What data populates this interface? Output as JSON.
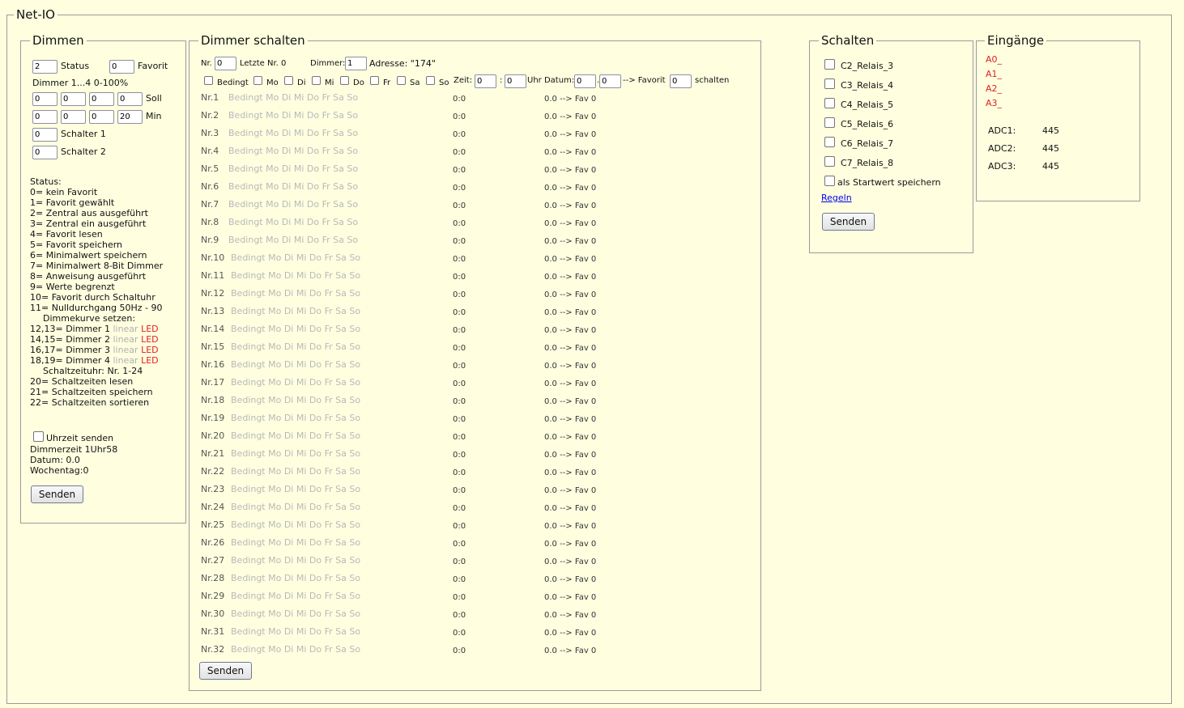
{
  "netio": {
    "legend": "Net-IO"
  },
  "dimmen": {
    "legend": "Dimmen",
    "status_value": "2",
    "status_label": "Status",
    "favorit_value": "0",
    "favorit_label": "Favorit",
    "range_label": "Dimmer 1...4 0-100%",
    "soll_values": [
      "0",
      "0",
      "0",
      "0"
    ],
    "soll_label": "Soll",
    "min_values": [
      "0",
      "0",
      "0",
      "20"
    ],
    "min_label": "Min",
    "schalter1_value": "0",
    "schalter1_label": "Schalter 1",
    "schalter2_value": "0",
    "schalter2_label": "Schalter 2",
    "status_header": "Status:",
    "status_lines": [
      "0= kein Favorit",
      "1= Favorit gewählt",
      "2= Zentral aus ausgeführt",
      "3= Zentral ein ausgeführt",
      "4= Favorit lesen",
      "5= Favorit speichern",
      "6= Minimalwert speichern",
      "7= Minimalwert 8-Bit Dimmer",
      "8= Anweisung ausgeführt",
      "9= Werte begrenzt",
      "10= Favorit durch Schaltuhr",
      "11= Nulldurchgang 50Hz - 90"
    ],
    "dimmkurve_label": "Dimmekurve setzen:",
    "curve_lines": [
      {
        "prefix": "12,13= Dimmer 1",
        "linear": "linear",
        "led": "LED"
      },
      {
        "prefix": "14,15= Dimmer 2",
        "linear": "linear",
        "led": "LED"
      },
      {
        "prefix": "16,17= Dimmer 3",
        "linear": "linear",
        "led": "LED"
      },
      {
        "prefix": "18,19= Dimmer 4",
        "linear": "linear",
        "led": "LED"
      }
    ],
    "schaltzeituhr_label": "Schaltzeituhr: Nr. 1-24",
    "schalt_lines": [
      "20= Schaltzeiten lesen",
      "21= Schaltzeiten speichern",
      "22= Schaltzeiten sortieren"
    ],
    "uhrzeit_label": "Uhrzeit senden",
    "dimmerzeit": "Dimmerzeit 1Uhr58",
    "datum": "Datum: 0.0",
    "wochentag": "Wochentag:0",
    "send_label": "Senden"
  },
  "dimmer_schalten": {
    "legend": "Dimmer schalten",
    "nr_label": "Nr.",
    "nr_value": "0",
    "letzte_label": "Letzte Nr. 0",
    "dimmer_label": "Dimmer:",
    "dimmer_value": "1",
    "adresse_label": "Adresse: \"174\"",
    "day_labels": [
      "Bedingt",
      "Mo",
      "Di",
      "Mi",
      "Do",
      "Fr",
      "Sa",
      "So"
    ],
    "zeit_label": "Zeit:",
    "zeit_h": "0",
    "zeit_sep": ":",
    "zeit_m": "0",
    "uhr_datum_label": "Uhr Datum:",
    "datum_d": "0",
    "datum_sep": ".",
    "datum_m": "0",
    "favorit_label": "--> Favorit",
    "favorit_value": "0",
    "schalten_label": "schalten",
    "day_text": "Bedingt Mo Di Mi Do Fr Sa So",
    "rows": [
      {
        "nr": "Nr.1",
        "time": "0:0",
        "fav": "0.0 --> Fav 0"
      },
      {
        "nr": "Nr.2",
        "time": "0:0",
        "fav": "0.0 --> Fav 0"
      },
      {
        "nr": "Nr.3",
        "time": "0:0",
        "fav": "0.0 --> Fav 0"
      },
      {
        "nr": "Nr.4",
        "time": "0:0",
        "fav": "0.0 --> Fav 0"
      },
      {
        "nr": "Nr.5",
        "time": "0:0",
        "fav": "0.0 --> Fav 0"
      },
      {
        "nr": "Nr.6",
        "time": "0:0",
        "fav": "0.0 --> Fav 0"
      },
      {
        "nr": "Nr.7",
        "time": "0:0",
        "fav": "0.0 --> Fav 0"
      },
      {
        "nr": "Nr.8",
        "time": "0:0",
        "fav": "0.0 --> Fav 0"
      },
      {
        "nr": "Nr.9",
        "time": "0:0",
        "fav": "0.0 --> Fav 0"
      },
      {
        "nr": "Nr.10",
        "time": "0:0",
        "fav": "0.0 --> Fav 0"
      },
      {
        "nr": "Nr.11",
        "time": "0:0",
        "fav": "0.0 --> Fav 0"
      },
      {
        "nr": "Nr.12",
        "time": "0:0",
        "fav": "0.0 --> Fav 0"
      },
      {
        "nr": "Nr.13",
        "time": "0:0",
        "fav": "0.0 --> Fav 0"
      },
      {
        "nr": "Nr.14",
        "time": "0:0",
        "fav": "0.0 --> Fav 0"
      },
      {
        "nr": "Nr.15",
        "time": "0:0",
        "fav": "0.0 --> Fav 0"
      },
      {
        "nr": "Nr.16",
        "time": "0:0",
        "fav": "0.0 --> Fav 0"
      },
      {
        "nr": "Nr.17",
        "time": "0:0",
        "fav": "0.0 --> Fav 0"
      },
      {
        "nr": "Nr.18",
        "time": "0:0",
        "fav": "0.0 --> Fav 0"
      },
      {
        "nr": "Nr.19",
        "time": "0:0",
        "fav": "0.0 --> Fav 0"
      },
      {
        "nr": "Nr.20",
        "time": "0:0",
        "fav": "0.0 --> Fav 0"
      },
      {
        "nr": "Nr.21",
        "time": "0:0",
        "fav": "0.0 --> Fav 0"
      },
      {
        "nr": "Nr.22",
        "time": "0:0",
        "fav": "0.0 --> Fav 0"
      },
      {
        "nr": "Nr.23",
        "time": "0:0",
        "fav": "0.0 --> Fav 0"
      },
      {
        "nr": "Nr.24",
        "time": "0:0",
        "fav": "0.0 --> Fav 0"
      },
      {
        "nr": "Nr.25",
        "time": "0:0",
        "fav": "0.0 --> Fav 0"
      },
      {
        "nr": "Nr.26",
        "time": "0:0",
        "fav": "0.0 --> Fav 0"
      },
      {
        "nr": "Nr.27",
        "time": "0:0",
        "fav": "0.0 --> Fav 0"
      },
      {
        "nr": "Nr.28",
        "time": "0:0",
        "fav": "0.0 --> Fav 0"
      },
      {
        "nr": "Nr.29",
        "time": "0:0",
        "fav": "0.0 --> Fav 0"
      },
      {
        "nr": "Nr.30",
        "time": "0:0",
        "fav": "0.0 --> Fav 0"
      },
      {
        "nr": "Nr.31",
        "time": "0:0",
        "fav": "0.0 --> Fav 0"
      },
      {
        "nr": "Nr.32",
        "time": "0:0",
        "fav": "0.0 --> Fav 0"
      }
    ],
    "send_label": "Senden"
  },
  "schalten": {
    "legend": "Schalten",
    "relays": [
      "C2_Relais_3",
      "C3_Relais_4",
      "C4_Relais_5",
      "C5_Relais_6",
      "C6_Relais_7",
      "C7_Relais_8"
    ],
    "startwert_label": "als Startwert speichern",
    "regeln_label": "Regeln",
    "send_label": "Senden"
  },
  "eingaenge": {
    "legend": "Eingänge",
    "inputs": [
      "A0_",
      "A1_",
      "A2_",
      "A3_"
    ],
    "adc": [
      {
        "label": "ADC1:",
        "value": "445"
      },
      {
        "label": "ADC2:",
        "value": "445"
      },
      {
        "label": "ADC3:",
        "value": "445"
      }
    ]
  },
  "colors": {
    "background": "#ffffe0",
    "border": "#9a9a9a",
    "red_text": "#e02020",
    "grey_text": "#b0b0b0",
    "link": "#0000ee"
  }
}
